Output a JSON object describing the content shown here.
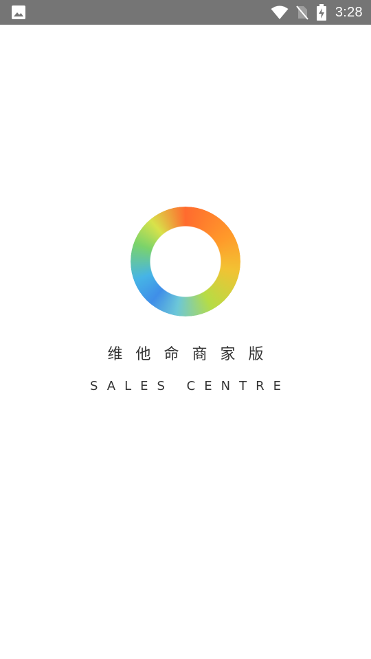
{
  "status_bar": {
    "time": "3:28",
    "icons": [
      "image-icon",
      "wifi-icon",
      "no-sim-icon",
      "battery-charging-icon"
    ],
    "background_color": "#757575"
  },
  "splash": {
    "title_cn": "维他命商家版",
    "title_en": "SALES CENTRE",
    "logo_icon": "rainbow-ring-icon",
    "text_color": "#333333"
  }
}
